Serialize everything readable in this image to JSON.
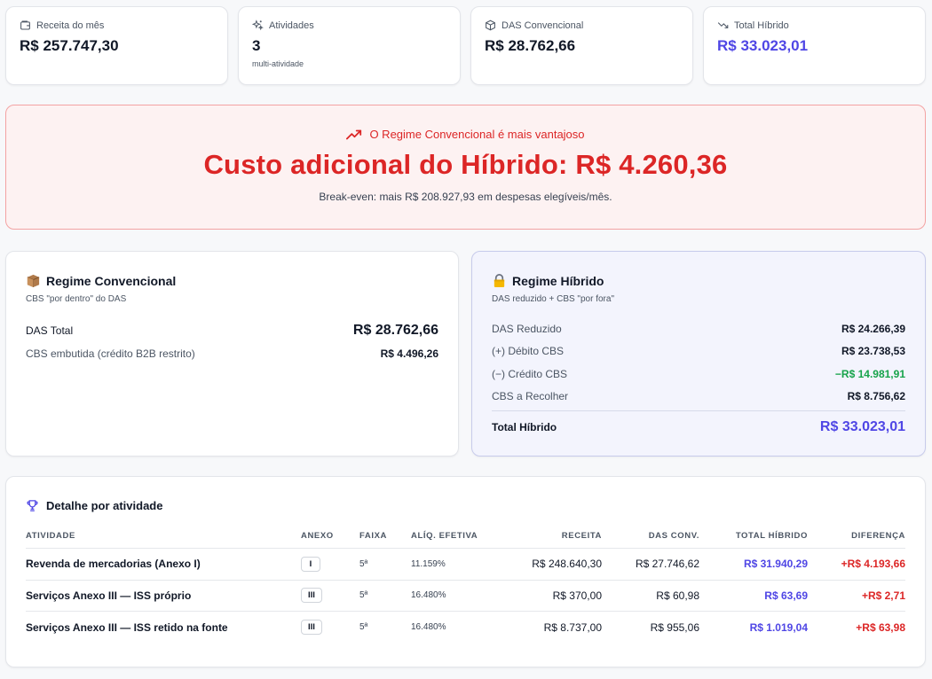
{
  "kpis": [
    {
      "label": "Receita do mês",
      "value": "R$ 257.747,30",
      "icon": "wallet-icon"
    },
    {
      "label": "Atividades",
      "value": "3",
      "sub": "multi-atividade",
      "icon": "sparkles-icon"
    },
    {
      "label": "DAS Convencional",
      "value": "R$ 28.762,66",
      "icon": "box-icon"
    },
    {
      "label": "Total Híbrido",
      "value": "R$ 33.023,01",
      "icon": "trending-down-icon"
    }
  ],
  "alert": {
    "heading": "O Regime Convencional é mais vantajoso",
    "title": "Custo adicional do Híbrido: R$ 4.260,36",
    "note": "Break-even: mais R$ 208.927,93 em despesas elegíveis/mês."
  },
  "convencional": {
    "title": "Regime Convencional",
    "subtitle": "CBS \"por dentro\" do DAS",
    "das_label": "DAS Total",
    "das_value": "R$ 28.762,66",
    "cbs_label": "CBS embutida (crédito B2B restrito)",
    "cbs_value": "R$ 4.496,26"
  },
  "hibrido": {
    "title": "Regime Híbrido",
    "subtitle": "DAS reduzido + CBS \"por fora\"",
    "rows": [
      {
        "label": "DAS Reduzido",
        "value": "R$ 24.266,39"
      },
      {
        "label": "(+) Débito CBS",
        "value": "R$ 23.738,53"
      },
      {
        "label": "(−) Crédito CBS",
        "value": "−R$ 14.981,91"
      },
      {
        "label": "CBS a Recolher",
        "value": "R$ 8.756,62"
      }
    ],
    "total_label": "Total Híbrido",
    "total_value": "R$ 33.023,01"
  },
  "detail": {
    "title": "Detalhe por atividade",
    "headers": [
      "Atividade",
      "Anexo",
      "Faixa",
      "Alíq. Efetiva",
      "Receita",
      "DAS Conv.",
      "Total Híbrido",
      "Diferença"
    ],
    "rows": [
      {
        "atividade": "Revenda de mercadorias (Anexo I)",
        "anexo": "I",
        "faixa": "5ª",
        "aliquota": "11.159%",
        "receita": "R$ 248.640,30",
        "das": "R$ 27.746,62",
        "total": "R$ 31.940,29",
        "diferenca": "+R$ 4.193,66"
      },
      {
        "atividade": "Serviços Anexo III — ISS próprio",
        "anexo": "III",
        "faixa": "5ª",
        "aliquota": "16.480%",
        "receita": "R$ 370,00",
        "das": "R$ 60,98",
        "total": "R$ 63,69",
        "diferenca": "+R$ 2,71"
      },
      {
        "atividade": "Serviços Anexo III — ISS retido na fonte",
        "anexo": "III",
        "faixa": "5ª",
        "aliquota": "16.480%",
        "receita": "R$ 8.737,00",
        "das": "R$ 955,06",
        "total": "R$ 1.019,04",
        "diferenca": "+R$ 63,98"
      }
    ]
  },
  "colors": {
    "accent_red": "#dc2626",
    "accent_purple": "#4f46e5",
    "credit_green": "#16a34a"
  }
}
